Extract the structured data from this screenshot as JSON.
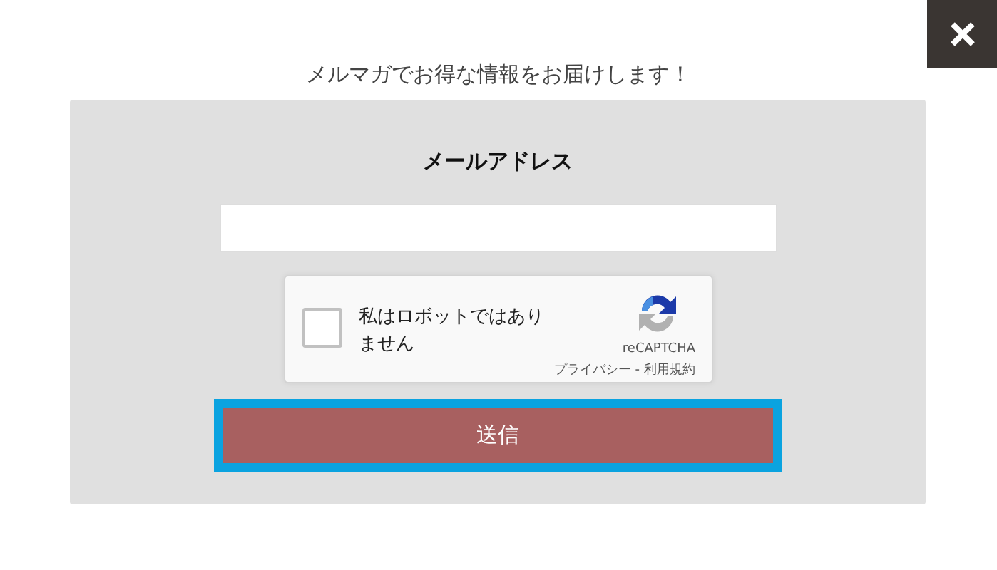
{
  "heading": "メルマガでお得な情報をお届けします！",
  "form": {
    "label": "メールアドレス",
    "captcha": {
      "checked": false,
      "text": "私はロボットではありません",
      "brand": "reCAPTCHA",
      "privacy": "プライバシー",
      "separator": "-",
      "terms": "利用規約"
    },
    "submit": {
      "label": "送信",
      "focused": true
    }
  },
  "close_button": {
    "kind": "close"
  }
}
